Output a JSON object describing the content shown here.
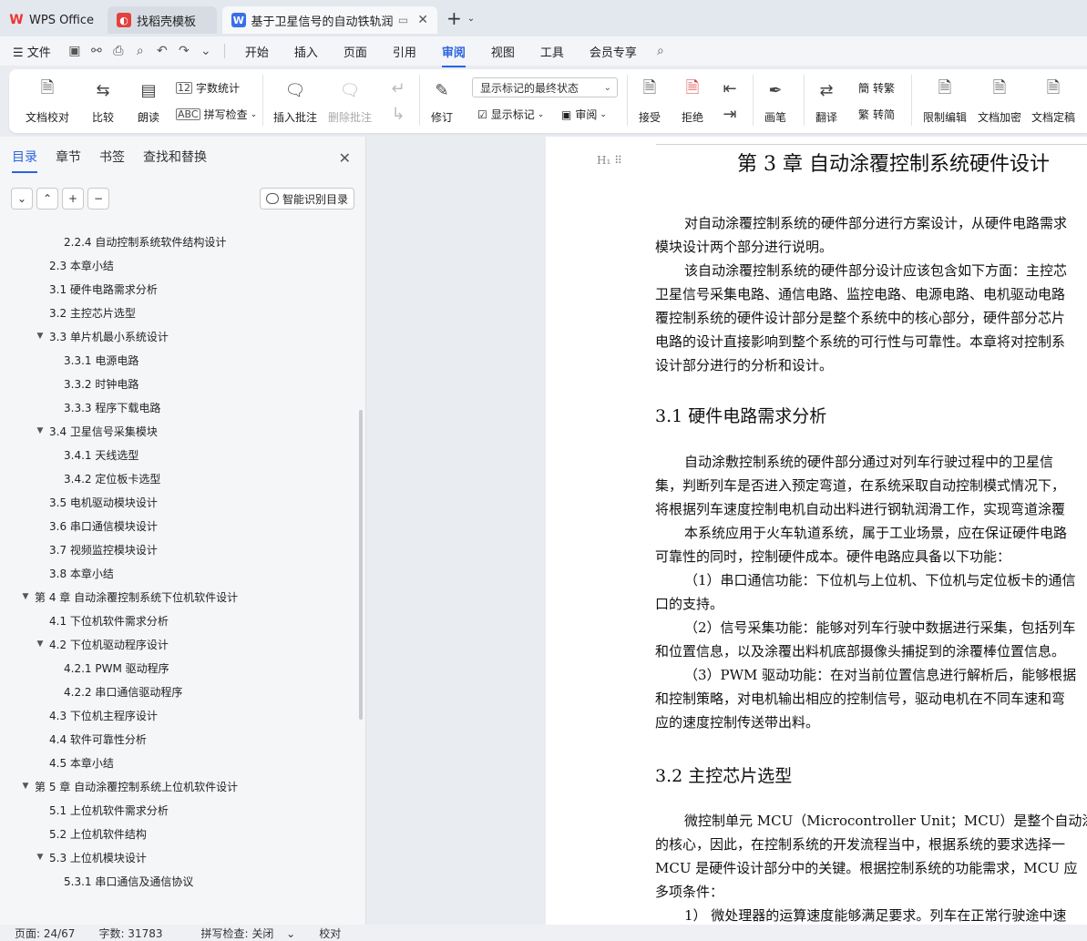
{
  "tabs": {
    "wps": "WPS Office",
    "template": "找稻壳模板",
    "document": "基于卫星信号的自动铁轨润滑"
  },
  "menu": [
    "文件",
    "开始",
    "插入",
    "页面",
    "引用",
    "审阅",
    "视图",
    "工具",
    "会员专享"
  ],
  "active_menu": "审阅",
  "ribbon": {
    "doc_check": "文档校对",
    "compare": "比较",
    "read_aloud": "朗读",
    "word_count": "字数统计",
    "spell_check": "拼写检查",
    "insert_comment": "插入批注",
    "delete_comment": "删除批注",
    "track": "修订",
    "markup_state": "显示标记的最终状态",
    "show_markup": "显示标记",
    "review": "审阅",
    "accept": "接受",
    "reject": "拒绝",
    "pen": "画笔",
    "translate": "翻译",
    "to_trad": "转繁",
    "to_simp": "转简",
    "restrict_edit": "限制编辑",
    "encrypt": "文档加密",
    "finalize": "文档定稿"
  },
  "nav": {
    "tabs": [
      "目录",
      "章节",
      "书签",
      "查找和替换"
    ],
    "smart_toc": "智能识别目录",
    "toc": [
      {
        "text": "2.2.4  自动控制系统软件结构设计",
        "level": 3
      },
      {
        "text": "2.3  本章小结",
        "level": 2
      },
      {
        "text": "第 3 章  自动涂覆控制系统硬件设计",
        "level": 1,
        "selected": true
      },
      {
        "text": "3.1  硬件电路需求分析",
        "level": 2
      },
      {
        "text": "3.2  主控芯片选型",
        "level": 2
      },
      {
        "text": "3.3  单片机最小系统设计",
        "level": 2,
        "expand": true
      },
      {
        "text": "3.3.1  电源电路",
        "level": 3
      },
      {
        "text": "3.3.2  时钟电路",
        "level": 3
      },
      {
        "text": "3.3.3  程序下载电路",
        "level": 3
      },
      {
        "text": "3.4  卫星信号采集模块",
        "level": 2,
        "expand": true
      },
      {
        "text": "3.4.1  天线选型",
        "level": 3
      },
      {
        "text": "3.4.2  定位板卡选型",
        "level": 3
      },
      {
        "text": "3.5  电机驱动模块设计",
        "level": 2
      },
      {
        "text": "3.6  串口通信模块设计",
        "level": 2
      },
      {
        "text": "3.7  视频监控模块设计",
        "level": 2
      },
      {
        "text": "3.8  本章小结",
        "level": 2
      },
      {
        "text": "第 4 章  自动涂覆控制系统下位机软件设计",
        "level": 1,
        "expand": true
      },
      {
        "text": "4.1  下位机软件需求分析",
        "level": 2
      },
      {
        "text": "4.2  下位机驱动程序设计",
        "level": 2,
        "expand": true
      },
      {
        "text": "4.2.1 PWM 驱动程序",
        "level": 3
      },
      {
        "text": "4.2.2  串口通信驱动程序",
        "level": 3
      },
      {
        "text": "4.3  下位机主程序设计",
        "level": 2
      },
      {
        "text": "4.4  软件可靠性分析",
        "level": 2
      },
      {
        "text": "4.5  本章小结",
        "level": 2
      },
      {
        "text": "第 5 章  自动涂覆控制系统上位机软件设计",
        "level": 1,
        "expand": true
      },
      {
        "text": "5.1  上位机软件需求分析",
        "level": 2
      },
      {
        "text": "5.2  上位机软件结构",
        "level": 2
      },
      {
        "text": "5.3  上位机模块设计",
        "level": 2,
        "expand": true
      },
      {
        "text": "5.3.1  串口通信及通信协议",
        "level": 3
      }
    ]
  },
  "document": {
    "heading_mark": "H₁",
    "chapter_title": "第 3 章  自动涂覆控制系统硬件设计",
    "block1": [
      "对自动涂覆控制系统的硬件部分进行方案设计，从硬件电路需求",
      "模块设计两个部分进行说明。",
      "该自动涂覆控制系统的硬件部分设计应该包含如下方面：主控芯",
      "卫星信号采集电路、通信电路、监控电路、电源电路、电机驱动电路",
      "覆控制系统的硬件设计部分是整个系统中的核心部分，硬件部分芯片",
      "电路的设计直接影响到整个系统的可行性与可靠性。本章将对控制系",
      "设计部分进行的分析和设计。"
    ],
    "sec1": "3.1  硬件电路需求分析",
    "block2": [
      "自动涂敷控制系统的硬件部分通过对列车行驶过程中的卫星信",
      "集，判断列车是否进入预定弯道，在系统采取自动控制模式情况下，",
      "将根据列车速度控制电机自动出料进行钢轨润滑工作，实现弯道涂覆",
      "本系统应用于火车轨道系统，属于工业场景，应在保证硬件电路",
      "可靠性的同时，控制硬件成本。硬件电路应具备以下功能：",
      "（1）串口通信功能：下位机与上位机、下位机与定位板卡的通信",
      "口的支持。",
      "（2）信号采集功能：能够对列车行驶中数据进行采集，包括列车",
      "和位置信息，以及涂覆出料机底部摄像头捕捉到的涂覆棒位置信息。",
      "（3）PWM 驱动功能：在对当前位置信息进行解析后，能够根据",
      "和控制策略，对电机输出相应的控制信号，驱动电机在不同车速和弯",
      "应的速度控制传送带出料。"
    ],
    "sec2": "3.2  主控芯片选型",
    "block3": [
      "微控制单元 MCU（Microcontroller Unit；MCU）是整个自动涂覆",
      "的核心，因此，在控制系统的开发流程当中，根据系统的要求选择一",
      "MCU 是硬件设计部分中的关键。根据控制系统的功能需求，MCU 应",
      "多项条件：",
      "1）  微处理器的运算速度能够满足要求。列车在正常行驶途中速"
    ]
  },
  "status": {
    "page": "页面: 24/67",
    "words": "字数: 31783",
    "spell": "拼写检查: 关闭",
    "proof": "校对"
  }
}
